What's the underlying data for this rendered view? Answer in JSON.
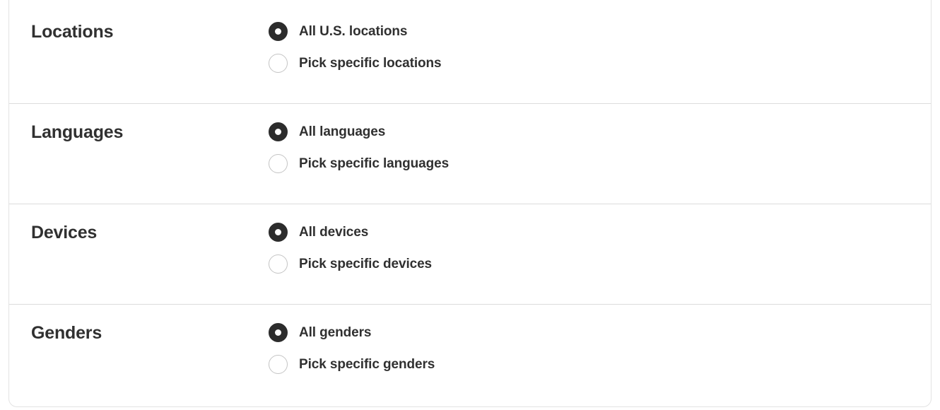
{
  "card": {
    "accent_color": "#2c2c2c",
    "border_color": "#dcdcdc",
    "text_color": "#303030"
  },
  "sections": [
    {
      "label": "Locations",
      "options": [
        {
          "label": "All U.S. locations",
          "selected": true
        },
        {
          "label": "Pick specific locations",
          "selected": false
        }
      ]
    },
    {
      "label": "Languages",
      "options": [
        {
          "label": "All languages",
          "selected": true
        },
        {
          "label": "Pick specific languages",
          "selected": false
        }
      ]
    },
    {
      "label": "Devices",
      "options": [
        {
          "label": "All devices",
          "selected": true
        },
        {
          "label": "Pick specific devices",
          "selected": false
        }
      ]
    },
    {
      "label": "Genders",
      "options": [
        {
          "label": "All genders",
          "selected": true
        },
        {
          "label": "Pick specific genders",
          "selected": false
        }
      ]
    }
  ]
}
